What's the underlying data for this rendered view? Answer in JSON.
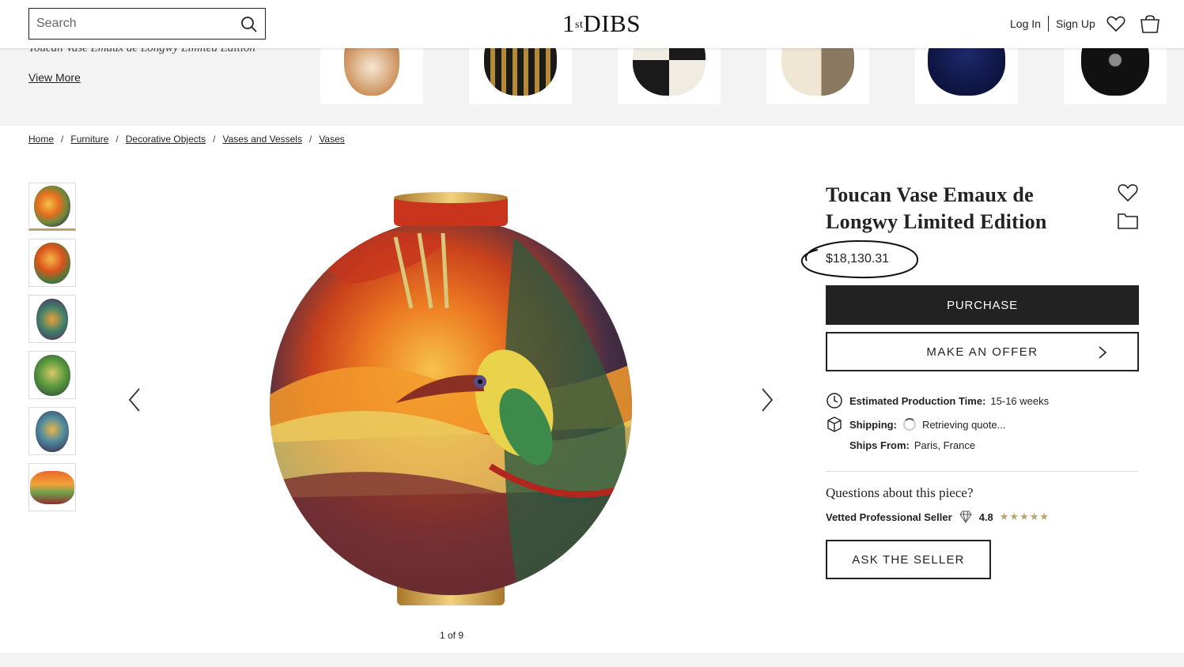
{
  "header": {
    "search_placeholder": "Search",
    "logo_main": "1stDIBS",
    "logo_sup": "st",
    "logo_left": "1",
    "logo_right": "DIBS",
    "login": "Log In",
    "signup": "Sign Up"
  },
  "recent": {
    "title": "Toucan Vase Emaux de Longwy Limited Edition",
    "view_more": "View More"
  },
  "breadcrumb": [
    "Home",
    "Furniture",
    "Decorative Objects",
    "Vases and Vessels",
    "Vases"
  ],
  "gallery": {
    "counter": "1 of 9"
  },
  "product": {
    "title": "Toucan Vase Emaux de Longwy Limited Edition",
    "price": "$18,130.31",
    "purchase": "PURCHASE",
    "offer": "MAKE AN OFFER",
    "production_label": "Estimated Production Time:",
    "production_value": "15-16 weeks",
    "shipping_label": "Shipping:",
    "shipping_value": "Retrieving quote...",
    "ships_from_label": "Ships From:",
    "ships_from_value": "Paris, France",
    "questions": "Questions about this piece?",
    "seller_label": "Vetted Professional Seller",
    "rating": "4.8",
    "stars": "★★★★★",
    "ask": "ASK THE SELLER"
  },
  "colors": {
    "accent_gold": "#b8a46a",
    "dark": "#222222",
    "strip_bg": "#f3f3f3"
  }
}
